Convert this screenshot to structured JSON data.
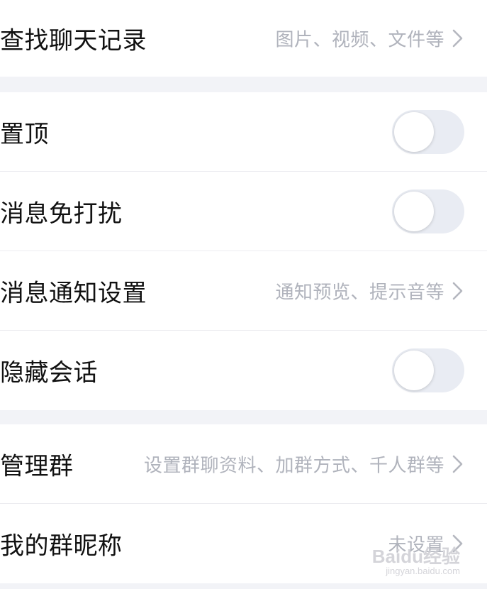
{
  "rows": {
    "search_history": {
      "label": "查找聊天记录",
      "detail": "图片、视频、文件等"
    },
    "pin_top": {
      "label": "置顶",
      "toggle_on": false
    },
    "do_not_disturb": {
      "label": "消息免打扰",
      "toggle_on": false
    },
    "notification_settings": {
      "label": "消息通知设置",
      "detail": "通知预览、提示音等"
    },
    "hide_conversation": {
      "label": "隐藏会话",
      "toggle_on": false
    },
    "manage_group": {
      "label": "管理群",
      "detail": "设置群聊资料、加群方式、千人群等"
    },
    "group_nickname": {
      "label": "我的群昵称",
      "detail": "未设置"
    }
  },
  "watermark": {
    "main": "Baidu经验",
    "sub": "jingyan.baidu.com"
  },
  "colors": {
    "background": "#f2f3f7",
    "row_background": "#ffffff",
    "label_text": "#111111",
    "detail_text": "#b0b3bc",
    "toggle_off_track": "#e9ecf3"
  }
}
